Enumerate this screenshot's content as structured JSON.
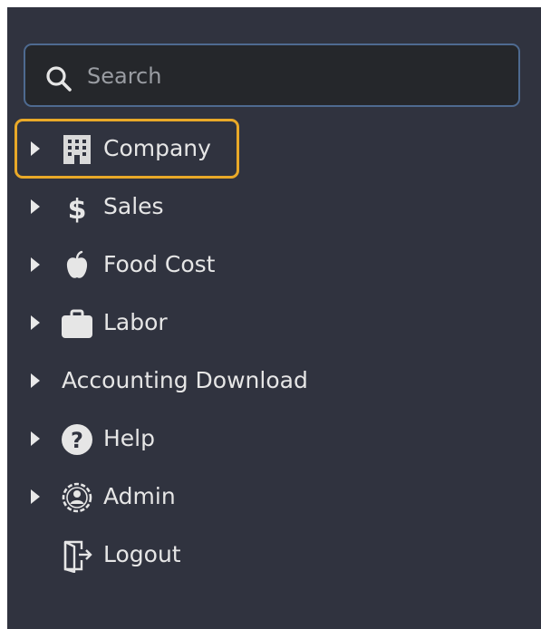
{
  "search": {
    "placeholder": "Search",
    "value": ""
  },
  "menu": {
    "items": [
      {
        "label": "Company",
        "icon": "building-icon",
        "expandable": true,
        "highlighted": true
      },
      {
        "label": "Sales",
        "icon": "dollar-icon",
        "expandable": true
      },
      {
        "label": "Food Cost",
        "icon": "apple-icon",
        "expandable": true
      },
      {
        "label": "Labor",
        "icon": "briefcase-icon",
        "expandable": true
      },
      {
        "label": "Accounting Download",
        "icon": "",
        "expandable": true
      },
      {
        "label": "Help",
        "icon": "question-circle-icon",
        "expandable": true
      },
      {
        "label": "Admin",
        "icon": "user-gear-icon",
        "expandable": true
      },
      {
        "label": "Logout",
        "icon": "sign-out-icon",
        "expandable": false
      }
    ]
  },
  "colors": {
    "sidebar_bg": "#30333f",
    "search_bg": "#25272b",
    "search_border": "#4e6a90",
    "highlight": "#e9a928",
    "text": "#e6e6e6"
  }
}
